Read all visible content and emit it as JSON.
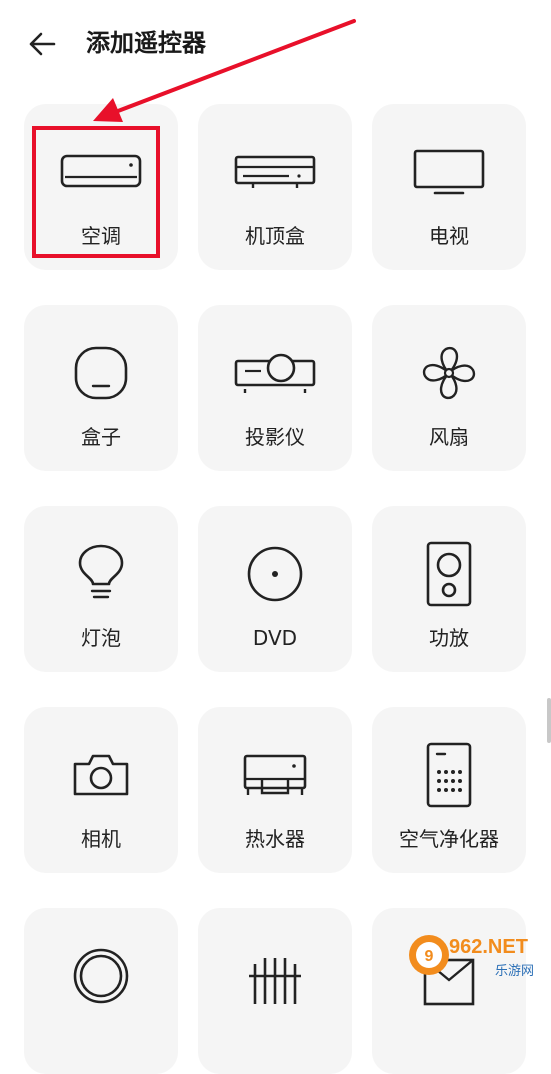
{
  "header": {
    "title": "添加遥控器",
    "back_icon": "back-arrow-icon"
  },
  "devices": [
    {
      "label": "空调",
      "icon": "air-conditioner-icon"
    },
    {
      "label": "机顶盒",
      "icon": "set-top-box-icon"
    },
    {
      "label": "电视",
      "icon": "tv-icon"
    },
    {
      "label": "盒子",
      "icon": "box-icon"
    },
    {
      "label": "投影仪",
      "icon": "projector-icon"
    },
    {
      "label": "风扇",
      "icon": "fan-icon"
    },
    {
      "label": "灯泡",
      "icon": "lightbulb-icon"
    },
    {
      "label": "DVD",
      "icon": "dvd-icon"
    },
    {
      "label": "功放",
      "icon": "amplifier-icon"
    },
    {
      "label": "相机",
      "icon": "camera-icon"
    },
    {
      "label": "热水器",
      "icon": "water-heater-icon"
    },
    {
      "label": "空气净化器",
      "icon": "air-purifier-icon"
    }
  ],
  "annotation": {
    "color": "#e8102a"
  },
  "watermark": {
    "brand": "962.NET",
    "subtitle": "乐游网"
  }
}
